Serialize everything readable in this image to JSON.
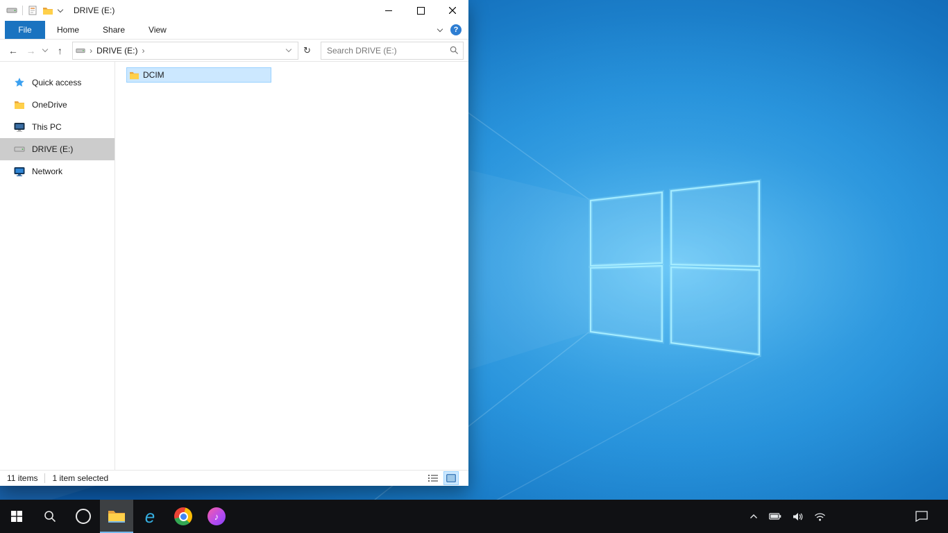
{
  "window": {
    "title": "DRIVE (E:)"
  },
  "ribbon": {
    "file_tab": "File",
    "tabs": [
      "Home",
      "Share",
      "View"
    ],
    "help": "?"
  },
  "address": {
    "breadcrumb": "DRIVE (E:)",
    "chevron": "›",
    "search_placeholder": "Search DRIVE (E:)"
  },
  "glyphs": {
    "back": "←",
    "forward": "→",
    "up": "↑",
    "refresh": "↻",
    "ie": "e",
    "music_note": "♪"
  },
  "sidebar": {
    "items": [
      {
        "label": "Quick access",
        "icon": "star-icon"
      },
      {
        "label": "OneDrive",
        "icon": "folder-icon"
      },
      {
        "label": "This PC",
        "icon": "computer-icon"
      },
      {
        "label": "DRIVE (E:)",
        "icon": "drive-icon",
        "selected": true
      },
      {
        "label": "Network",
        "icon": "network-icon"
      }
    ]
  },
  "files": {
    "items": [
      {
        "name": "DCIM",
        "icon": "folder-icon",
        "selected": true
      }
    ]
  },
  "status": {
    "count": "11 items",
    "selection": "1 item selected"
  },
  "colors": {
    "file_tab_bg": "#1a73c0",
    "selection_bg": "#cce8ff",
    "selection_border": "#99d1ff",
    "sidebar_selected_bg": "#cccccc",
    "taskbar_bg": "#101114",
    "wallpaper_center": "#4ab3ee",
    "wallpaper_edge": "#0c58a4"
  }
}
